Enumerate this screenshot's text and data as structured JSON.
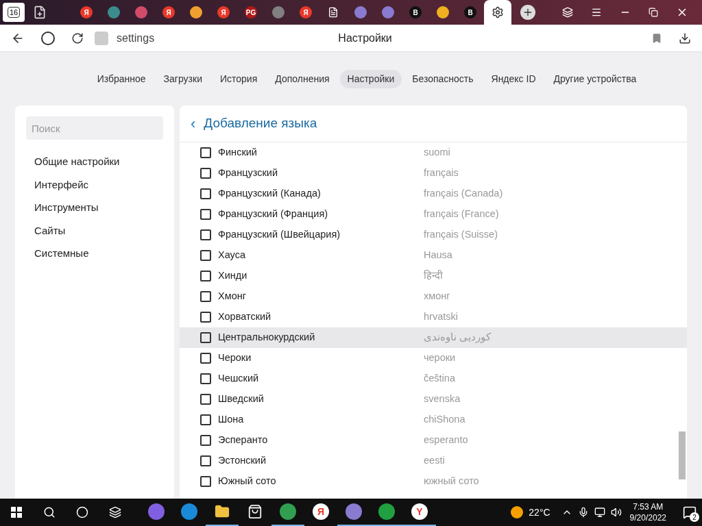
{
  "tabs_bar": {
    "home_count": "16",
    "tabs": [
      {
        "kind": "letter",
        "glyph": "Я",
        "color": "#e8392a",
        "selected": false
      },
      {
        "kind": "plain",
        "color": "#3b8c8c",
        "selected": false
      },
      {
        "kind": "plain",
        "color": "#d04a6a",
        "selected": false
      },
      {
        "kind": "letter",
        "glyph": "Я",
        "color": "#e8392a",
        "selected": false
      },
      {
        "kind": "plain",
        "color": "#f0a030",
        "selected": false
      },
      {
        "kind": "letter",
        "glyph": "Я",
        "color": "#e8392a",
        "selected": false
      },
      {
        "kind": "letter",
        "glyph": "PG",
        "color": "#b01818",
        "selected": false
      },
      {
        "kind": "plain",
        "color": "#808080",
        "selected": false
      },
      {
        "kind": "letter",
        "glyph": "Я",
        "color": "#e8392a",
        "selected": false
      },
      {
        "kind": "page",
        "color": "#ffffff",
        "selected": false
      },
      {
        "kind": "plain",
        "color": "#8a7ad0",
        "selected": false
      },
      {
        "kind": "plain",
        "color": "#8a7ad0",
        "selected": false
      },
      {
        "kind": "letter",
        "glyph": "B",
        "color": "#111111",
        "selected": false
      },
      {
        "kind": "plain",
        "color": "#f0b020",
        "selected": false
      },
      {
        "kind": "letter",
        "glyph": "B",
        "color": "#111111",
        "selected": false
      },
      {
        "kind": "gear",
        "color": "#333333",
        "selected": true
      }
    ]
  },
  "address_bar": {
    "url": "settings",
    "page_title": "Настройки"
  },
  "nav": [
    {
      "label": "Избранное",
      "selected": false
    },
    {
      "label": "Загрузки",
      "selected": false
    },
    {
      "label": "История",
      "selected": false
    },
    {
      "label": "Дополнения",
      "selected": false
    },
    {
      "label": "Настройки",
      "selected": true
    },
    {
      "label": "Безопасность",
      "selected": false
    },
    {
      "label": "Яндекс ID",
      "selected": false
    },
    {
      "label": "Другие устройства",
      "selected": false
    }
  ],
  "sidebar": {
    "search_placeholder": "Поиск",
    "items": [
      "Общие настройки",
      "Интерфейс",
      "Инструменты",
      "Сайты",
      "Системные"
    ]
  },
  "panel": {
    "back": "‹",
    "title": "Добавление языка",
    "languages": [
      {
        "name": "Финский",
        "native": "suomi",
        "checked": false,
        "hovered": false
      },
      {
        "name": "Французский",
        "native": "français",
        "checked": false,
        "hovered": false
      },
      {
        "name": "Французский (Канада)",
        "native": "français (Canada)",
        "checked": false,
        "hovered": false
      },
      {
        "name": "Французский (Франция)",
        "native": "français (France)",
        "checked": false,
        "hovered": false
      },
      {
        "name": "Французский (Швейцария)",
        "native": "français (Suisse)",
        "checked": false,
        "hovered": false
      },
      {
        "name": "Хауса",
        "native": "Hausa",
        "checked": false,
        "hovered": false
      },
      {
        "name": "Хинди",
        "native": "हिन्दी",
        "checked": false,
        "hovered": false
      },
      {
        "name": "Хмонг",
        "native": "хмонг",
        "checked": false,
        "hovered": false
      },
      {
        "name": "Хорватский",
        "native": "hrvatski",
        "checked": false,
        "hovered": false
      },
      {
        "name": "Центральнокурдский",
        "native": "کوردیی ناوەندی",
        "checked": false,
        "hovered": true
      },
      {
        "name": "Чероки",
        "native": "чероки",
        "checked": false,
        "hovered": false
      },
      {
        "name": "Чешский",
        "native": "čeština",
        "checked": false,
        "hovered": false
      },
      {
        "name": "Шведский",
        "native": "svenska",
        "checked": false,
        "hovered": false
      },
      {
        "name": "Шона",
        "native": "chiShona",
        "checked": false,
        "hovered": false
      },
      {
        "name": "Эсперанто",
        "native": "esperanto",
        "checked": false,
        "hovered": false
      },
      {
        "name": "Эстонский",
        "native": "eesti",
        "checked": false,
        "hovered": false
      },
      {
        "name": "Южный сото",
        "native": "южный сото",
        "checked": false,
        "hovered": false
      }
    ]
  },
  "taskbar": {
    "apps": [
      {
        "kind": "circle",
        "color": "#8060e0",
        "active": false
      },
      {
        "kind": "circle",
        "color": "#1a8ad8",
        "active": false
      },
      {
        "kind": "folder",
        "color": "#f0c040",
        "active": true
      },
      {
        "kind": "store",
        "color": "#f0f0f0",
        "active": false
      },
      {
        "kind": "circle",
        "color": "#30a050",
        "active": true
      },
      {
        "kind": "letter",
        "glyph": "Я",
        "color": "#e8392a",
        "active": false
      },
      {
        "kind": "circle",
        "color": "#8a7ad0",
        "active": true
      },
      {
        "kind": "circle",
        "color": "#20a040",
        "active": true
      },
      {
        "kind": "letter",
        "glyph": "Y",
        "color": "#e8392a",
        "active": true
      }
    ],
    "temperature": "22°C",
    "time": "7:53 AM",
    "date": "9/20/2022",
    "notifications": "2"
  }
}
